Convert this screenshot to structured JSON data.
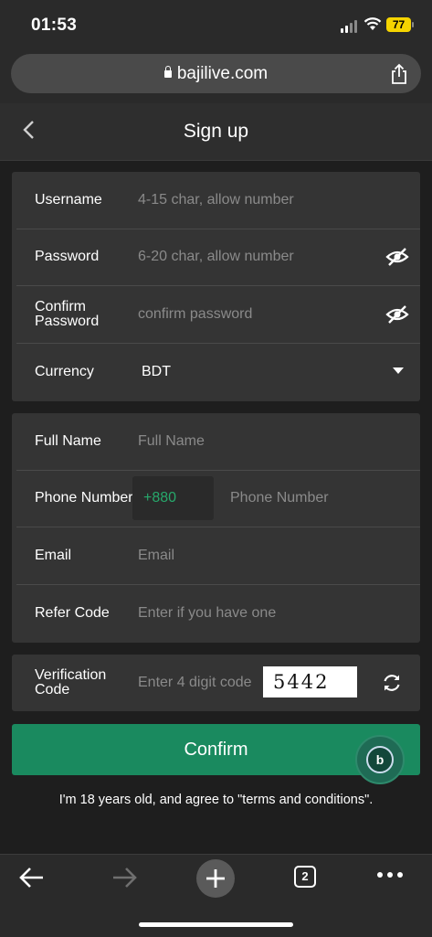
{
  "status_bar": {
    "time": "01:53",
    "battery": "77"
  },
  "browser": {
    "url": "bajilive.com",
    "tab_count": "2"
  },
  "header": {
    "title": "Sign up"
  },
  "account_section": {
    "username": {
      "label": "Username",
      "placeholder": "4-15 char, allow number"
    },
    "password": {
      "label": "Password",
      "placeholder": "6-20 char, allow number"
    },
    "confirm_password": {
      "label": "Confirm Password",
      "placeholder": "confirm password"
    },
    "currency": {
      "label": "Currency",
      "value": "BDT"
    }
  },
  "personal_section": {
    "full_name": {
      "label": "Full Name",
      "placeholder": "Full Name"
    },
    "phone": {
      "label": "Phone Number",
      "prefix": "+880",
      "placeholder": "Phone Number"
    },
    "email": {
      "label": "Email",
      "placeholder": "Email"
    },
    "refer_code": {
      "label": "Refer Code",
      "placeholder": "Enter if you have one"
    }
  },
  "verification": {
    "label": "Verification Code",
    "placeholder": "Enter 4 digit code",
    "captcha": "5442"
  },
  "confirm_label": "Confirm",
  "support_badge": "b",
  "terms_text": "I'm 18 years old, and agree to \"terms and conditions\".",
  "colors": {
    "accent_green": "#1a8a5f",
    "prefix_green": "#27a86b",
    "background": "#1e1e1e",
    "card": "#343434"
  }
}
